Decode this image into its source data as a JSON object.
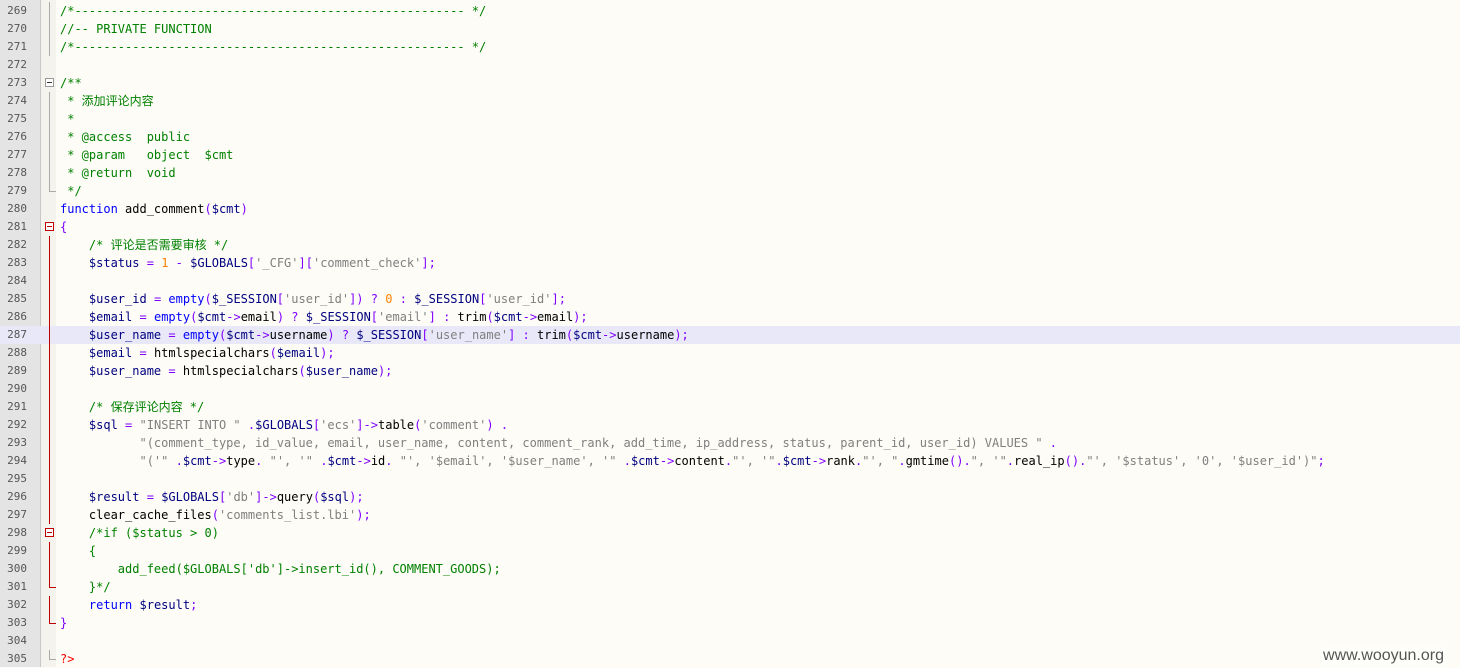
{
  "editor": {
    "lines": [
      {
        "n": "269",
        "text": "/*------------------------------------------------------ */",
        "kind": "comment",
        "fold": "line"
      },
      {
        "n": "270",
        "text": "//-- PRIVATE FUNCTION",
        "kind": "comment",
        "fold": "line"
      },
      {
        "n": "271",
        "text": "/*------------------------------------------------------ */",
        "kind": "comment",
        "fold": "line"
      },
      {
        "n": "272",
        "text": "",
        "kind": "plain",
        "fold": ""
      },
      {
        "n": "273",
        "text": "/**",
        "kind": "comment",
        "fold": "box"
      },
      {
        "n": "274",
        "text": " * 添加评论内容",
        "kind": "comment",
        "fold": "line"
      },
      {
        "n": "275",
        "text": " *",
        "kind": "comment",
        "fold": "line"
      },
      {
        "n": "276",
        "text": " * @access  public",
        "kind": "comment",
        "fold": "line"
      },
      {
        "n": "277",
        "text": " * @param   object  $cmt",
        "kind": "comment",
        "fold": "line"
      },
      {
        "n": "278",
        "text": " * @return  void",
        "kind": "comment",
        "fold": "line"
      },
      {
        "n": "279",
        "text": " */",
        "kind": "comment",
        "fold": "end"
      },
      {
        "n": "280",
        "text": "function add_comment($cmt)",
        "kind": "code",
        "fold": ""
      },
      {
        "n": "281",
        "text": "{",
        "kind": "code",
        "fold": "redbox"
      },
      {
        "n": "282",
        "text": "    /* 评论是否需要审核 */",
        "kind": "comment",
        "fold": "redline"
      },
      {
        "n": "283",
        "text": "    $status = 1 - $GLOBALS['_CFG']['comment_check'];",
        "kind": "code",
        "fold": "redline"
      },
      {
        "n": "284",
        "text": "",
        "kind": "plain",
        "fold": "redline"
      },
      {
        "n": "285",
        "text": "    $user_id = empty($_SESSION['user_id']) ? 0 : $_SESSION['user_id'];",
        "kind": "code",
        "fold": "redline"
      },
      {
        "n": "286",
        "text": "    $email = empty($cmt->email) ? $_SESSION['email'] : trim($cmt->email);",
        "kind": "code",
        "fold": "redline"
      },
      {
        "n": "287",
        "text": "    $user_name = empty($cmt->username) ? $_SESSION['user_name'] : trim($cmt->username);",
        "kind": "code",
        "fold": "redline",
        "highlight": true
      },
      {
        "n": "288",
        "text": "    $email = htmlspecialchars($email);",
        "kind": "code",
        "fold": "redline"
      },
      {
        "n": "289",
        "text": "    $user_name = htmlspecialchars($user_name);",
        "kind": "code",
        "fold": "redline"
      },
      {
        "n": "290",
        "text": "",
        "kind": "plain",
        "fold": "redline"
      },
      {
        "n": "291",
        "text": "    /* 保存评论内容 */",
        "kind": "comment",
        "fold": "redline"
      },
      {
        "n": "292",
        "text": "    $sql = \"INSERT INTO \" .$GLOBALS['ecs']->table('comment') .",
        "kind": "code",
        "fold": "redline"
      },
      {
        "n": "293",
        "text": "           \"(comment_type, id_value, email, user_name, content, comment_rank, add_time, ip_address, status, parent_id, user_id) VALUES \" .",
        "kind": "code",
        "fold": "redline"
      },
      {
        "n": "294",
        "text": "           \"('\" .$cmt->type. \"', '\" .$cmt->id. \"', '$email', '$user_name', '\" .$cmt->content.\"', '\".$cmt->rank.\"', \".gmtime().\", '\".real_ip().\"', '$status', '0', '$user_id')\";",
        "kind": "code",
        "fold": "redline"
      },
      {
        "n": "295",
        "text": "",
        "kind": "plain",
        "fold": "redline"
      },
      {
        "n": "296",
        "text": "    $result = $GLOBALS['db']->query($sql);",
        "kind": "code",
        "fold": "redline"
      },
      {
        "n": "297",
        "text": "    clear_cache_files('comments_list.lbi');",
        "kind": "code",
        "fold": "redline"
      },
      {
        "n": "298",
        "text": "    /*if ($status > 0)",
        "kind": "comment",
        "fold": "redbox"
      },
      {
        "n": "299",
        "text": "    {",
        "kind": "comment",
        "fold": "redline"
      },
      {
        "n": "300",
        "text": "        add_feed($GLOBALS['db']->insert_id(), COMMENT_GOODS);",
        "kind": "comment",
        "fold": "redline"
      },
      {
        "n": "301",
        "text": "    }*/",
        "kind": "comment",
        "fold": "redend"
      },
      {
        "n": "302",
        "text": "    return $result;",
        "kind": "code",
        "fold": "redline"
      },
      {
        "n": "303",
        "text": "}",
        "kind": "code",
        "fold": "redend"
      },
      {
        "n": "304",
        "text": "",
        "kind": "plain",
        "fold": ""
      },
      {
        "n": "305",
        "text": "?>",
        "kind": "php",
        "fold": "end"
      }
    ]
  },
  "watermark": "www.wooyun.org",
  "colors": {
    "comment": "#008000",
    "keyword": "#0000ff",
    "string": "#808080",
    "number": "#ff8000",
    "operator": "#8000ff",
    "gutter": "#e4e4e4",
    "highlight": "#e8e8f8"
  }
}
